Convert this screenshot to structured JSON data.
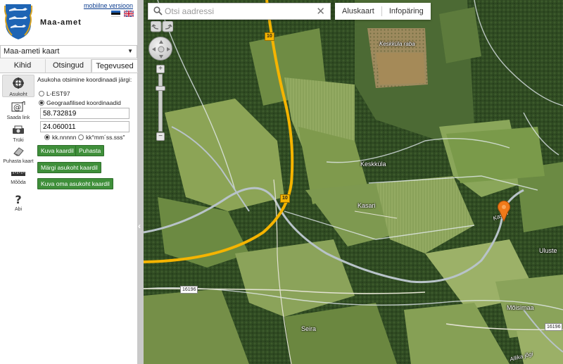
{
  "brand": {
    "name": "Maa-amet",
    "mobile_link": "mobiilne versioon"
  },
  "map_selector": {
    "value": "Maa-ameti kaart"
  },
  "tabs": [
    {
      "label": "Kihid",
      "active": false
    },
    {
      "label": "Otsingud",
      "active": false
    },
    {
      "label": "Tegevused",
      "active": true
    }
  ],
  "tools": [
    {
      "label": "Asukoht",
      "icon": "crosshair-icon",
      "active": true
    },
    {
      "label": "Saada link",
      "icon": "email-link-icon"
    },
    {
      "label": "Trüki",
      "icon": "print-icon"
    },
    {
      "label": "Puhasta kaart",
      "icon": "eraser-icon"
    },
    {
      "label": "Mõõda",
      "icon": "ruler-icon"
    },
    {
      "label": "Abi",
      "icon": "help-icon"
    }
  ],
  "location_panel": {
    "title": "Asukoha otsimine koordinaadi järgi:",
    "options": [
      {
        "label": "L-EST97",
        "selected": false
      },
      {
        "label": "Geograafilised koordinaadid",
        "selected": true
      }
    ],
    "lat_value": "58.732819",
    "lon_value": "24.060011",
    "format_options": [
      {
        "label": "kk.nnnnn",
        "selected": true
      },
      {
        "label": "kk°mm´ss.sss\"",
        "selected": false
      }
    ],
    "btn_show": "Kuva kaardil",
    "btn_clear": "Puhasta",
    "btn_mark": "Märgi asukoht kaardil",
    "btn_show_own": "Kuva oma asukoht kaardil"
  },
  "map": {
    "search_placeholder": "Otsi aadressi",
    "buttons": [
      "Aluskaart",
      "Infopäring"
    ],
    "zoom_level_fraction": 0.78,
    "labels": {
      "keskkula_raba": "Keskküla raba",
      "keskkula": "Keskküla",
      "kasari": "Kasari",
      "uluste": "Uluste",
      "moisimaa": "Mõisimaa",
      "seira": "Seira",
      "river_kasari": "Kasari",
      "river_allika": "Allika jõgi"
    },
    "road_numbers": [
      "10",
      "10"
    ],
    "road_shields": [
      "16196",
      "16196"
    ]
  },
  "colors": {
    "accent_green": "#3f8f3a",
    "road_orange": "#f5b400",
    "pin_orange": "#f07a1a",
    "logo_blue": "#1e64b4"
  }
}
